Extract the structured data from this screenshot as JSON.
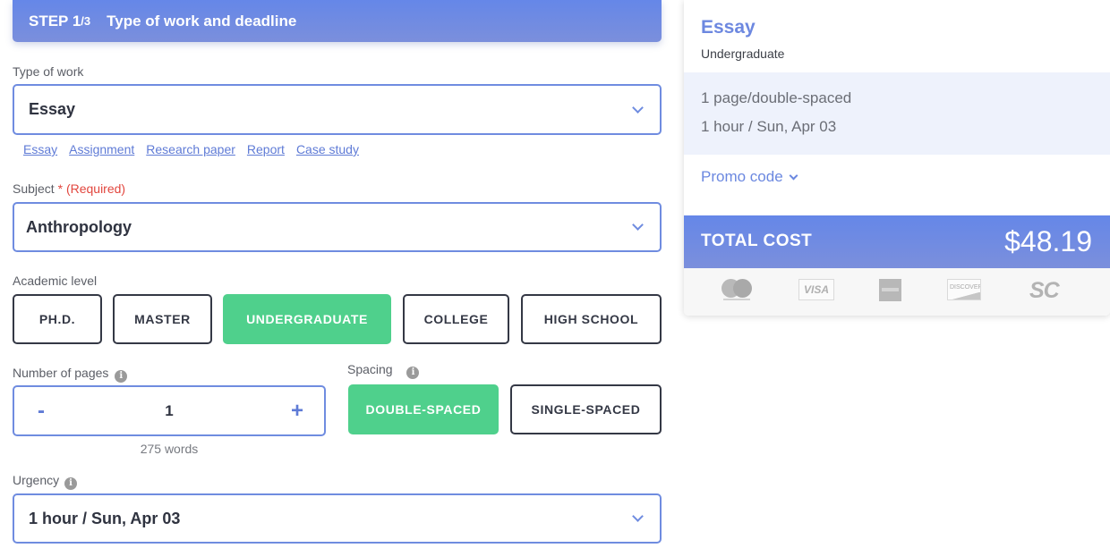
{
  "step": {
    "number": "STEP 1",
    "fraction": "/3",
    "title": "Type of work and deadline"
  },
  "type_of_work": {
    "label": "Type of work",
    "value": "Essay",
    "icon": "chevron-down-icon",
    "quick_links": [
      "Essay",
      "Assignment",
      "Research paper",
      "Report",
      "Case study"
    ]
  },
  "subject": {
    "label": "Subject",
    "required_mark": "*",
    "required_text": "(Required)",
    "value": "Anthropology",
    "icon": "chevron-down-icon"
  },
  "academic_level": {
    "label": "Academic level",
    "options": [
      "PH.D.",
      "MASTER",
      "UNDERGRADUATE",
      "COLLEGE",
      "HIGH SCHOOL"
    ],
    "selected": "UNDERGRADUATE"
  },
  "pages": {
    "label": "Number of pages",
    "info_icon": "i",
    "minus": "-",
    "value": "1",
    "plus": "+",
    "words": "275 words"
  },
  "spacing": {
    "label": "Spacing",
    "info_icon": "i",
    "options": [
      "DOUBLE-SPACED",
      "SINGLE-SPACED"
    ],
    "selected": "DOUBLE-SPACED"
  },
  "urgency": {
    "label": "Urgency",
    "info_icon": "i",
    "value": "1 hour / Sun, Apr 03",
    "icon": "chevron-down-icon"
  },
  "summary": {
    "title": "Essay",
    "level": "Undergraduate",
    "pages_line": "1 page/double-spaced",
    "deadline_line": "1 hour / Sun, Apr 03",
    "promo_label": "Promo code",
    "total_label": "TOTAL COST",
    "total_price": "$48.19",
    "payment_methods": {
      "mastercard": "mastercard-icon",
      "visa": "VISA",
      "amex": "amex-icon",
      "discover": "DISCOVER",
      "sc": "SC"
    }
  },
  "colors": {
    "accent_blue": "#6587e8",
    "selected_green": "#4fd08c",
    "required_red": "#e2463e",
    "dark_border": "#343845"
  }
}
